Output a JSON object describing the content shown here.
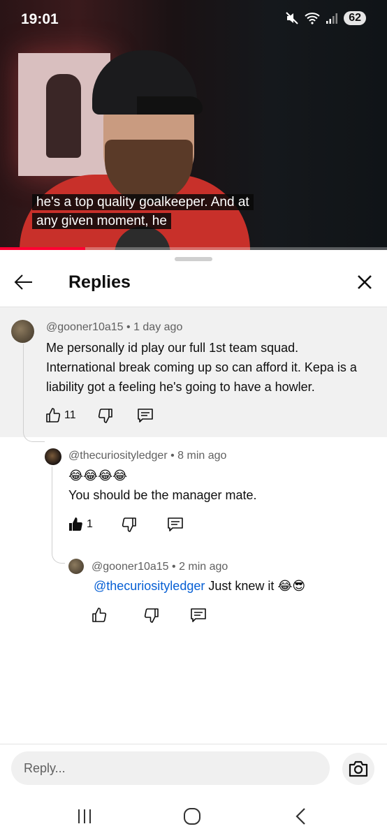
{
  "status_bar": {
    "time": "19:01",
    "battery": "62"
  },
  "video": {
    "caption_line1": "he's a top quality goalkeeper. And at",
    "caption_line2": "any given moment, he",
    "progress_fraction": 0.22
  },
  "header": {
    "title": "Replies"
  },
  "comments": [
    {
      "author": "@gooner10a15",
      "age": "1 day ago",
      "text": "Me personally id play our full 1st team squad. International break coming up so can afford it. Kepa is a liability got a feeling he's going to have a howler.",
      "likes": "11"
    },
    {
      "author": "@thecuriosityledger",
      "age": "8 min ago",
      "emoji": "😂😂😂😂",
      "text": "You should be the manager mate.",
      "likes": "1"
    },
    {
      "author": "@gooner10a15",
      "age": "2 min ago",
      "mention": "@thecuriosityledger",
      "text": " Just knew it 😂😎"
    }
  ],
  "reply_box": {
    "placeholder": "Reply..."
  },
  "colors": {
    "accent_red": "#ff0033",
    "link_blue": "#065fd4"
  }
}
